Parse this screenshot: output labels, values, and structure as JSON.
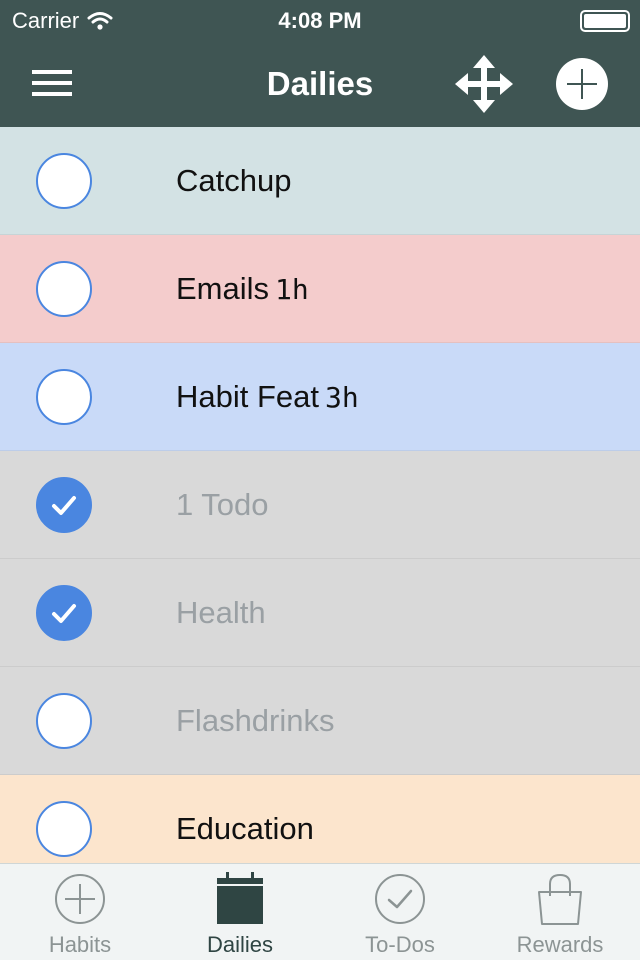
{
  "status_bar": {
    "carrier": "Carrier",
    "time": "4:08 PM",
    "battery_icon": "battery-full-icon",
    "wifi_icon": "wifi-icon"
  },
  "nav": {
    "title": "Dailies",
    "menu_icon": "hamburger-menu-icon",
    "move_icon": "move-arrows-icon",
    "add_icon": "plus-circle-icon",
    "background_color": "#3f5553"
  },
  "dailies": [
    {
      "label": "Catchup",
      "duration": "",
      "checked": false,
      "color": "#d3e2e4"
    },
    {
      "label": "Emails",
      "duration": "1h",
      "checked": false,
      "color": "#f4cccc"
    },
    {
      "label": "Habit Feat",
      "duration": "3h",
      "checked": false,
      "color": "#c9daf8"
    },
    {
      "label": "1 Todo",
      "duration": "",
      "checked": true,
      "color": "#d9d9d9"
    },
    {
      "label": "Health",
      "duration": "",
      "checked": true,
      "color": "#d9d9d9"
    },
    {
      "label": "Flashdrinks",
      "duration": "",
      "checked": false,
      "color": "#d9d9d9"
    },
    {
      "label": "Education",
      "duration": "",
      "checked": false,
      "color": "#fce5cd"
    }
  ],
  "tabs": [
    {
      "label": "Habits",
      "icon": "plus-circle-icon",
      "active": false
    },
    {
      "label": "Dailies",
      "icon": "calendar-icon",
      "active": true
    },
    {
      "label": "To-Dos",
      "icon": "checkmark-circle-icon",
      "active": false
    },
    {
      "label": "Rewards",
      "icon": "shopping-bag-icon",
      "active": false
    }
  ],
  "colors": {
    "accent": "#4a86e0",
    "completed_text": "#9aa0a4",
    "tab_active": "#2f4543",
    "tab_inactive": "#8c9494"
  }
}
